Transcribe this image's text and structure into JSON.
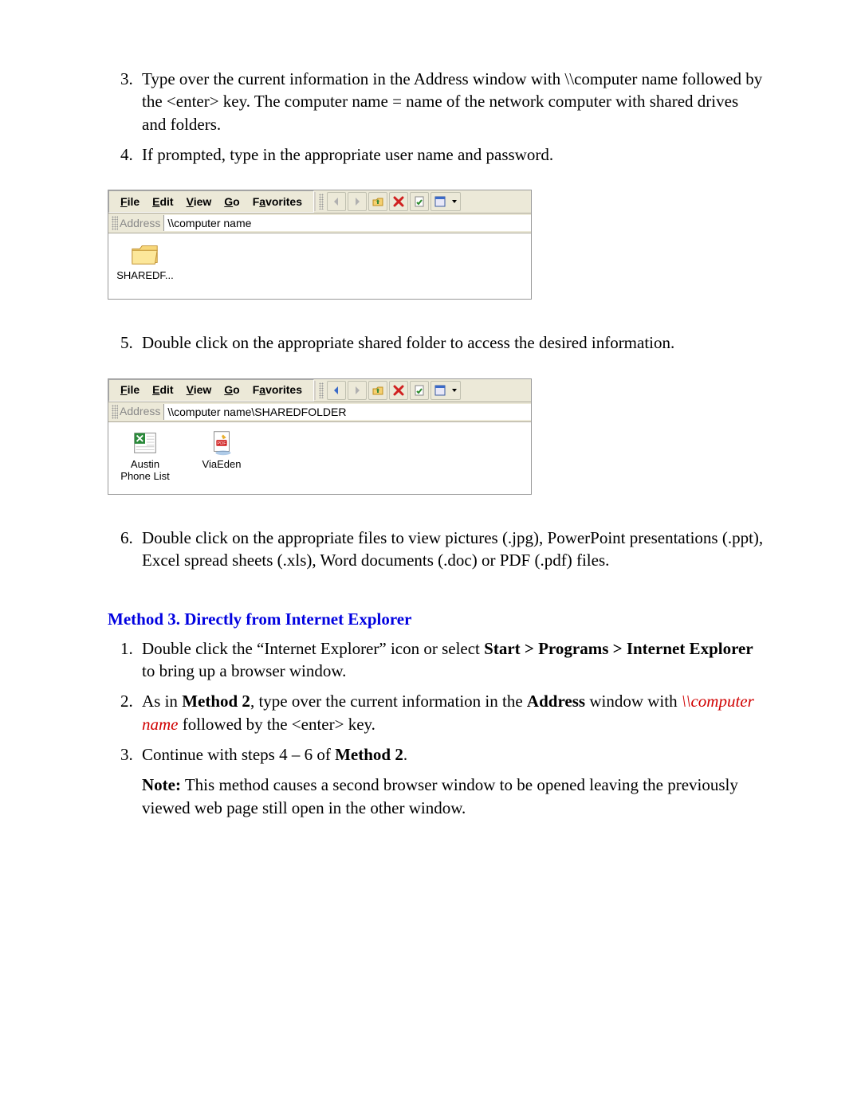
{
  "steps_a": {
    "s3": "Type over the current information in the Address window with \\\\computer name followed by the <enter> key.  The computer name = name of the network computer with shared drives and folders.",
    "s4": "If prompted, type in the appropriate user name and password."
  },
  "explorer1": {
    "menus": {
      "file": "File",
      "edit": "Edit",
      "view": "View",
      "go": "Go",
      "fav": "Favorites"
    },
    "address_label": "Address",
    "address_value": "\\\\computer name",
    "items": [
      {
        "label": "SHAREDF..."
      }
    ]
  },
  "steps_b": {
    "s5": "Double click on the appropriate shared folder to access the desired information."
  },
  "explorer2": {
    "menus": {
      "file": "File",
      "edit": "Edit",
      "view": "View",
      "go": "Go",
      "fav": "Favorites"
    },
    "address_label": "Address",
    "address_value": "\\\\computer name\\SHAREDFOLDER",
    "items": [
      {
        "label": "Austin Phone List",
        "type": "xls"
      },
      {
        "label": "ViaEden",
        "type": "pdf"
      }
    ]
  },
  "steps_c": {
    "s6": "Double click on the appropriate files to view pictures (.jpg), PowerPoint presentations (.ppt), Excel spread sheets (.xls), Word documents (.doc) or PDF (.pdf) files."
  },
  "method3": {
    "heading": "Method 3.  Directly from Internet Explorer",
    "li1_a": "Double click the “Internet Explorer” icon or select ",
    "li1_b": "Start > Programs > Internet Explorer",
    "li1_c": " to bring up a browser window.",
    "li2_a": "As in ",
    "li2_b": "Method 2",
    "li2_c": ", type over the current information in the ",
    "li2_d": "Address",
    "li2_e": " window with ",
    "li2_f": "\\\\computer name",
    "li2_g": " followed by the <enter> key.",
    "li3_a": "Continue with steps 4 – 6 of ",
    "li3_b": "Method 2",
    "li3_c": ".",
    "note_a": "Note:",
    "note_b": " This method causes a second browser window to be opened leaving the previously viewed web page still open in the other window."
  }
}
